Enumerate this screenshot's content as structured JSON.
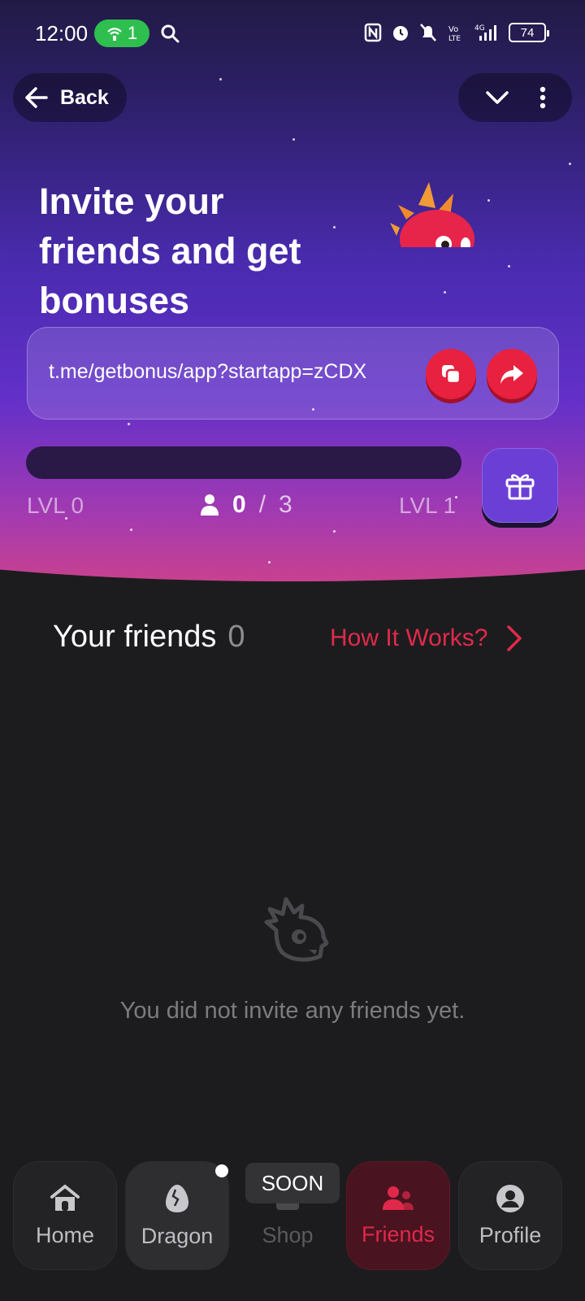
{
  "status_bar": {
    "time": "12:00",
    "hotspot_count": "1",
    "battery": "74"
  },
  "header": {
    "back_label": "Back"
  },
  "hero": {
    "title": "Invite your friends and get bonuses",
    "invite_link": "t.me/getbonus/app?startapp=zCDX",
    "level_current": "LVL 0",
    "level_next": "LVL 1",
    "friends_current": "0",
    "friends_separator": "/",
    "friends_required": "3",
    "progress_fraction": 0
  },
  "friends": {
    "title": "Your friends",
    "count": "0",
    "how_it_works": "How It Works?",
    "empty_message": "You did not invite any friends yet."
  },
  "nav": {
    "items": [
      {
        "label": "Home",
        "icon": "home-icon"
      },
      {
        "label": "Dragon",
        "icon": "egg-icon"
      },
      {
        "label": "Shop",
        "icon": "shop-icon",
        "badge": "SOON"
      },
      {
        "label": "Friends",
        "icon": "friends-icon"
      },
      {
        "label": "Profile",
        "icon": "profile-icon"
      }
    ]
  },
  "colors": {
    "accent": "#e7213f",
    "nav_active_bg": "#4a1320",
    "gift_button": "#6b3fd6",
    "background": "#1c1c1e"
  }
}
